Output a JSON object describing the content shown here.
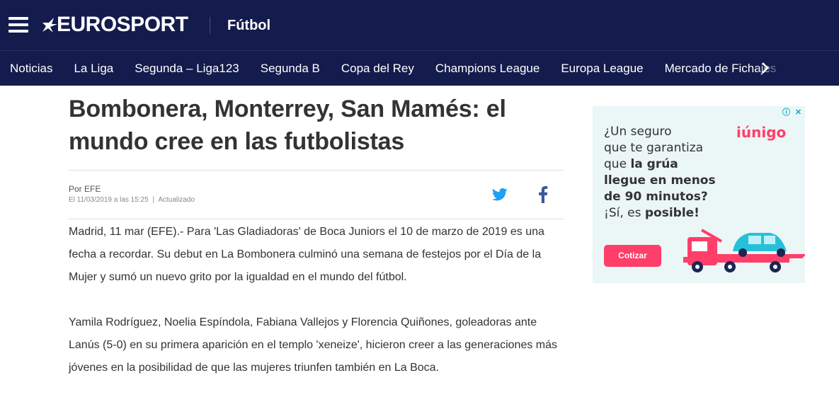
{
  "header": {
    "menu_icon": "hamburger-menu-icon",
    "logo_text": "EUROSPORT",
    "section": "Fútbol",
    "bg_color": "#141b4d"
  },
  "nav": {
    "items": [
      "Noticias",
      "La Liga",
      "Segunda – Liga123",
      "Segunda B",
      "Copa del Rey",
      "Champions League",
      "Europa League",
      "Mercado de Fichajes"
    ],
    "arrow_icon": "chevron-right-icon"
  },
  "article": {
    "headline": "Bombonera, Monterrey, San Mamés: el mundo cree en las futbolistas",
    "author": "Por EFE",
    "date": "El 11/03/2019 a las 15:25",
    "separator": "|",
    "updated": "Actualizado",
    "share_icons": [
      "twitter-icon",
      "facebook-icon"
    ],
    "paragraphs": [
      "Madrid, 11 mar (EFE).- Para 'Las Gladiadoras' de Boca Juniors el 10 de marzo de 2019 es una fecha a recordar. Su debut en La Bombonera culminó una semana de festejos por el Día de la Mujer y sumó un nuevo grito por la igualdad en el mundo del fútbol.",
      "Yamila Rodríguez, Noelia Espíndola, Fabiana Vallejos y Florencia Quiñones, goleadoras ante Lanús (5-0) en su primera aparición en el templo 'xeneize', hicieron creer a las generaciones más jóvenes en la posibilidad de que las mujeres triunfen también en La Boca."
    ]
  },
  "ad": {
    "brand": "iúnigo",
    "line1": "¿Un seguro",
    "line2": "que te garantiza",
    "line3_pre": "que ",
    "line3_bold": "la grúa",
    "line4": "llegue en menos",
    "line5": "de 90 minutos?",
    "line6_pre": "¡Sí, es ",
    "line6_bold": "posible!",
    "cta": "Cotizar",
    "info_icon": "info-icon",
    "close_icon": "close-icon",
    "accent": "#ff3e6a",
    "bg": "#ebf6f6"
  }
}
